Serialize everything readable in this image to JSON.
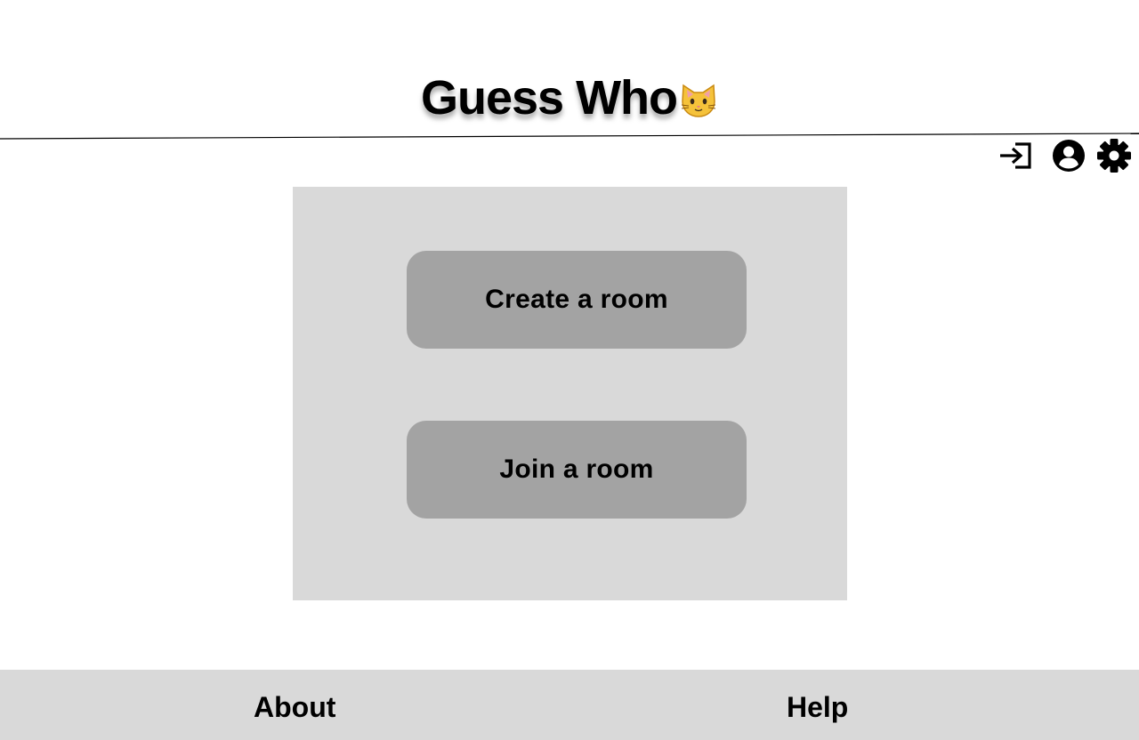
{
  "header": {
    "title": "Guess Who",
    "title_emoji": "🐱",
    "icons": [
      "login-icon",
      "account-icon",
      "settings-icon"
    ]
  },
  "main": {
    "create_room_label": "Create a room",
    "join_room_label": "Join a room"
  },
  "footer": {
    "about_label": "About",
    "help_label": "Help"
  },
  "colors": {
    "panel_bg": "#d9d9d9",
    "button_bg": "#a3a3a3",
    "footer_bg": "#d9d9d9",
    "text": "#000000"
  }
}
